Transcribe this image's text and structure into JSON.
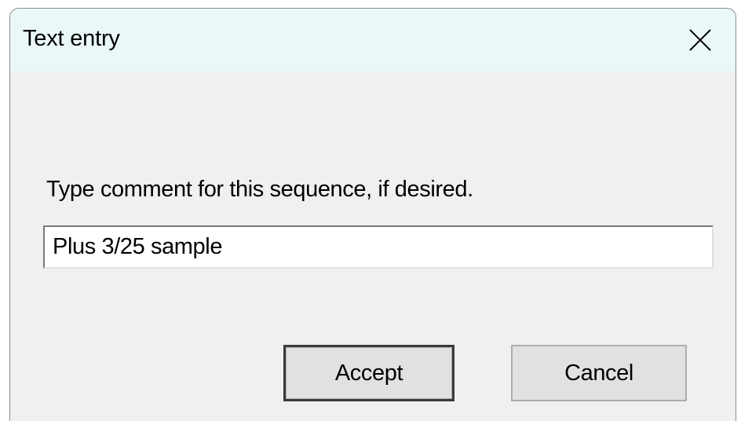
{
  "window": {
    "title": "Text entry",
    "close_icon": "close-icon"
  },
  "prompt": {
    "text": "Type comment for this sequence, if desired."
  },
  "comment_input": {
    "value": "Plus 3/25 sample"
  },
  "buttons": {
    "accept_label": "Accept",
    "cancel_label": "Cancel"
  },
  "colors": {
    "titlebar": "#eaf8f8",
    "dialog_background": "#f0f0f0",
    "button_face": "#e1e1e1"
  }
}
